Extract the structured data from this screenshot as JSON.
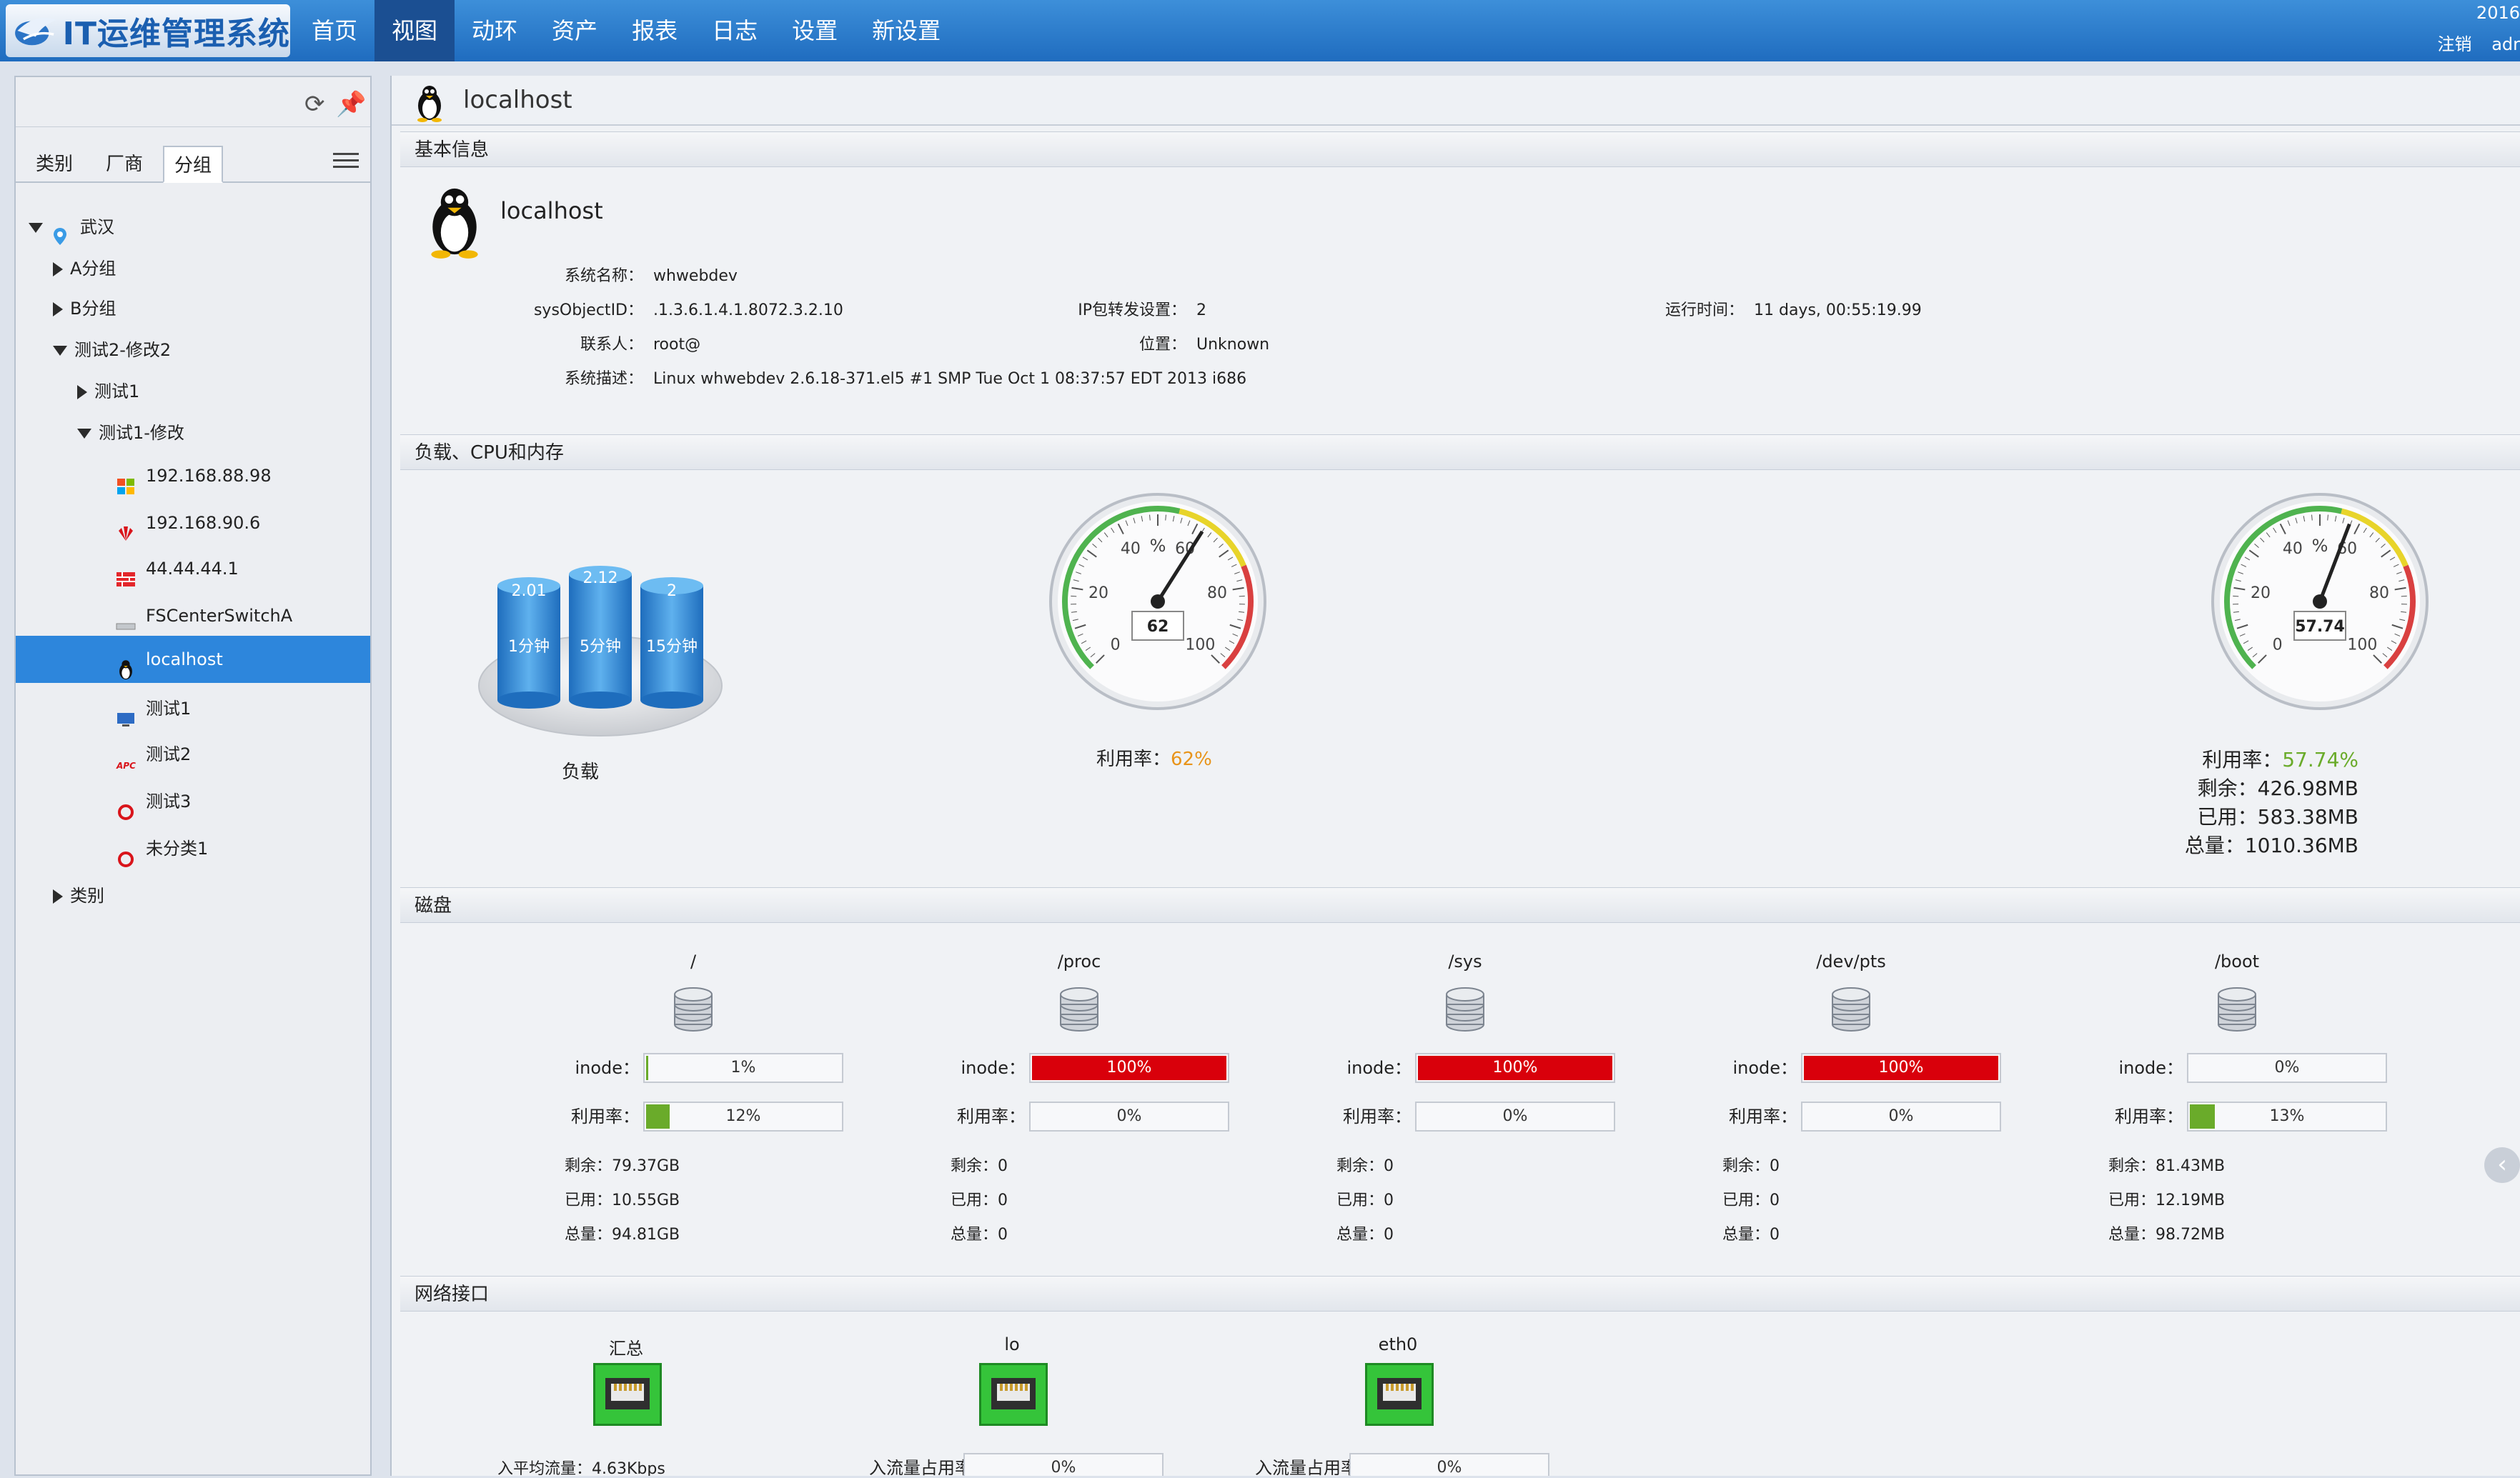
{
  "app": {
    "title": "IT运维管理系统"
  },
  "nav": [
    "首页",
    "视图",
    "动环",
    "资产",
    "报表",
    "日志",
    "设置",
    "新设置"
  ],
  "top_right": {
    "year": "2016",
    "logout": "注销",
    "user": "adr"
  },
  "sidebar": {
    "tabs": [
      "类别",
      "厂商",
      "分组"
    ],
    "tree": [
      {
        "label": "武汉"
      },
      {
        "label": "A分组"
      },
      {
        "label": "B分组"
      },
      {
        "label": "测试2-修改2"
      },
      {
        "label": "测试1"
      },
      {
        "label": "测试1-修改"
      },
      {
        "label": "192.168.88.98"
      },
      {
        "label": "192.168.90.6"
      },
      {
        "label": "44.44.44.1"
      },
      {
        "label": "FSCenterSwitchA"
      },
      {
        "label": "localhost"
      },
      {
        "label": "测试1"
      },
      {
        "label": "测试2"
      },
      {
        "label": "测试3"
      },
      {
        "label": "未分类1"
      },
      {
        "label": "类别"
      }
    ]
  },
  "main": {
    "title": "localhost",
    "basic": {
      "head": "基本信息",
      "hostname": "localhost",
      "sysname_k": "系统名称：",
      "sysname_v": "whwebdev",
      "oid_k": "sysObjectID：",
      "oid_v": ".1.3.6.1.4.1.8072.3.2.10",
      "ipfwd_k": "IP包转发设置：",
      "ipfwd_v": "2",
      "uptime_k": "运行时间：",
      "uptime_v": "11 days, 00:55:19.99",
      "contact_k": "联系人：",
      "contact_v": "root@",
      "location_k": "位置：",
      "location_v": "Unknown",
      "desc_k": "系统描述：",
      "desc_v": "Linux whwebdev 2.6.18-371.el5 #1 SMP Tue Oct 1 08:37:57 EDT 2013 i686"
    },
    "load": {
      "head": "负载、CPU和内存",
      "label": "负载",
      "values": [
        "2.01",
        "2.12",
        "2"
      ],
      "periods": [
        "1分钟",
        "5分钟",
        "15分钟"
      ]
    },
    "cpu": {
      "value": 62,
      "display": "62",
      "label": "利用率：",
      "pct": "62%",
      "unit": "%",
      "ticks": [
        "0",
        "20",
        "40",
        "60",
        "80",
        "100"
      ]
    },
    "mem": {
      "value": 57.74,
      "display": "57.74",
      "label": "利用率：",
      "pct": "57.74%",
      "unit": "%",
      "ticks": [
        "0",
        "20",
        "40",
        "60",
        "80",
        "100"
      ],
      "free_k": "剩余：",
      "free_v": "426.98MB",
      "used_k": "已用：",
      "used_v": "583.38MB",
      "total_k": "总量：",
      "total_v": "1010.36MB"
    },
    "disks_head": "磁盘",
    "disk_labels": {
      "inode": "inode：",
      "usage": "利用率：",
      "free": "剩余：",
      "used": "已用：",
      "total": "总量："
    },
    "disks": [
      {
        "name": "/",
        "inode": 1,
        "inode_txt": "1%",
        "usage": 12,
        "usage_txt": "12%",
        "free": "79.37GB",
        "used": "10.55GB",
        "total": "94.81GB"
      },
      {
        "name": "/proc",
        "inode": 100,
        "inode_txt": "100%",
        "usage": 0,
        "usage_txt": "0%",
        "free": "0",
        "used": "0",
        "total": "0"
      },
      {
        "name": "/sys",
        "inode": 100,
        "inode_txt": "100%",
        "usage": 0,
        "usage_txt": "0%",
        "free": "0",
        "used": "0",
        "total": "0"
      },
      {
        "name": "/dev/pts",
        "inode": 100,
        "inode_txt": "100%",
        "usage": 0,
        "usage_txt": "0%",
        "free": "0",
        "used": "0",
        "total": "0"
      },
      {
        "name": "/boot",
        "inode": 0,
        "inode_txt": "0%",
        "usage": 13,
        "usage_txt": "13%",
        "free": "81.43MB",
        "used": "12.19MB",
        "total": "98.72MB"
      }
    ],
    "net": {
      "head": "网络接口",
      "nics": [
        {
          "name": "汇总",
          "stat_k": "入平均流量：",
          "stat_v": "4.63Kbps"
        },
        {
          "name": "lo",
          "stat_k": "入流量占用率：",
          "stat_v": "0%"
        },
        {
          "name": "eth0",
          "stat_k": "入流量占用率：",
          "stat_v": "0%"
        }
      ]
    }
  },
  "colors": {
    "accent": "#2d86dc",
    "ok": "#6aab2a",
    "danger": "#d9000b",
    "cpu_pct": "#e8941a",
    "mem_pct": "#6aab2a"
  }
}
